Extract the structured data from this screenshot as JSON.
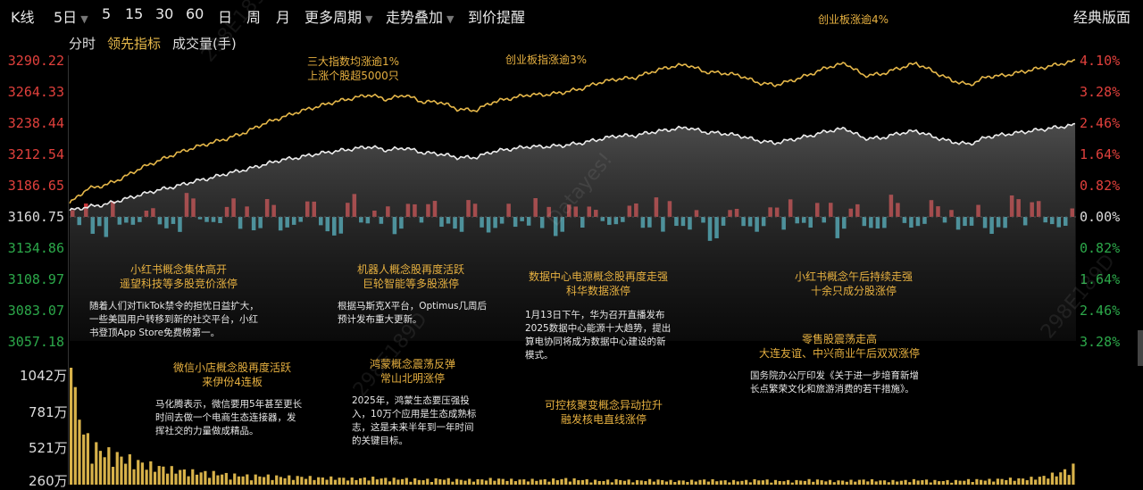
{
  "toolbar": {
    "chart_type": "K线",
    "period_5d": "5日",
    "p5": "5",
    "p15": "15",
    "p30": "30",
    "p60": "60",
    "day": "日",
    "week": "周",
    "month": "月",
    "more_periods": "更多周期",
    "trend_overlay": "走势叠加",
    "price_alert": "到价提醒",
    "classic_layout": "经典版面"
  },
  "subbar": {
    "timeshare": "分时",
    "leading_indicator": "领先指标",
    "volume": "成交量(手)"
  },
  "y_left": [
    "3290.22",
    "3264.33",
    "3238.44",
    "3212.54",
    "3186.65",
    "3160.75",
    "3134.86",
    "3108.97",
    "3083.07",
    "3057.18"
  ],
  "y_right": [
    "4.10%",
    "3.28%",
    "2.46%",
    "1.64%",
    "0.82%",
    "0.00%",
    "0.82%",
    "1.64%",
    "2.46%",
    "3.28%"
  ],
  "vol_labels": [
    "1042万",
    "781万",
    "521万",
    "260万"
  ],
  "watermarks": [
    "298E189D",
    "Datayes!",
    "298E189D",
    "298E189D"
  ],
  "annotations": [
    {
      "title": [
        "三大指数均涨逾1%",
        "上涨个股超5000只"
      ]
    },
    {
      "title": [
        "创业板指涨逾3%"
      ]
    },
    {
      "title": [
        "创业板涨逾4%"
      ]
    },
    {
      "title": [
        "小红书概念集体高开",
        "遥望科技等多股竞价涨停"
      ],
      "text": [
        "随着人们对TikTok禁令的担忧日益扩大，",
        "一些美国用户转移到新的社交平台，小红",
        "书登顶App Store免费榜第一。"
      ]
    },
    {
      "title": [
        "机器人概念股再度活跃",
        "巨轮智能等多股涨停"
      ],
      "text": [
        "根据马斯克X平台，Optimus几周后",
        "预计发布重大更新。"
      ]
    },
    {
      "title": [
        "数据中心电源概念股再度走强",
        "科华数据涨停"
      ],
      "text": [
        "1月13日下午，华为召开直播发布",
        "2025数据中心能源十大趋势，提出",
        "算电协同将成为数据中心建设的新",
        "模式。"
      ]
    },
    {
      "title": [
        "小红书概念午后持续走强",
        "十余只成分股涨停"
      ]
    },
    {
      "title": [
        "零售股震荡走高",
        "大连友谊、中兴商业午后双双涨停"
      ],
      "text": [
        "国务院办公厅印发《关于进一步培育新增",
        "长点繁荣文化和旅游消费的若干措施》。"
      ]
    },
    {
      "title": [
        "微信小店概念股再度活跃",
        "来伊份4连板"
      ],
      "text": [
        "马化腾表示，微信要用5年甚至更长",
        "时间去做一个电商生态连接器，发",
        "挥社交的力量做成精品。"
      ]
    },
    {
      "title": [
        "鸿蒙概念震荡反弹",
        "常山北明涨停"
      ],
      "text": [
        "2025年，鸿蒙生态要压强投",
        "入，10万个应用是生态成熟标",
        "志，这是未来半年到一年时间",
        "的关键目标。"
      ]
    },
    {
      "title": [
        "可控核聚变概念异动拉升",
        "融发核电直线涨停"
      ]
    }
  ],
  "chart_data": {
    "type": "line",
    "x": "intraday",
    "y_range": [
      3057.18,
      3290.22
    ],
    "base_value": 3160.75,
    "series": [
      {
        "color": "#e6b84a",
        "values": [
          3172,
          3184,
          3187,
          3193,
          3201,
          3207,
          3213,
          3218,
          3222,
          3226,
          3231,
          3238,
          3243,
          3248,
          3252,
          3256,
          3259,
          3262,
          3258,
          3262,
          3256,
          3256,
          3250,
          3249,
          3256,
          3259,
          3262,
          3262,
          3264,
          3267,
          3272,
          3275,
          3276,
          3281,
          3285,
          3287,
          3281,
          3280,
          3278,
          3272,
          3270,
          3274,
          3279,
          3285,
          3288,
          3278,
          3279,
          3284,
          3288,
          3281,
          3274,
          3270,
          3277,
          3278,
          3281,
          3284,
          3287,
          3290
        ]
      },
      {
        "color": "#ececec",
        "values": [
          3166,
          3169,
          3171,
          3175,
          3179,
          3183,
          3186,
          3190,
          3193,
          3197,
          3200,
          3204,
          3208,
          3210,
          3213,
          3215,
          3217,
          3219,
          3216,
          3218,
          3214,
          3213,
          3210,
          3210,
          3215,
          3217,
          3219,
          3219,
          3220,
          3222,
          3225,
          3228,
          3228,
          3231,
          3233,
          3235,
          3231,
          3230,
          3228,
          3224,
          3222,
          3225,
          3228,
          3232,
          3234,
          3226,
          3226,
          3230,
          3232,
          3227,
          3223,
          3221,
          3227,
          3229,
          3231,
          3233,
          3235,
          3237
        ]
      }
    ],
    "bars": [
      0.5,
      -0.8,
      0.6,
      -0.3,
      0.4,
      -0.5,
      0.9,
      -0.2,
      0.5,
      0.7,
      -0.6,
      0.8,
      -0.4,
      0.6,
      -0.7,
      1.0,
      -0.3,
      0.4,
      -0.9,
      0.5,
      0.6,
      -0.5,
      0.8,
      -0.6,
      0.5,
      -0.4,
      0.7,
      -0.8,
      0.6,
      0.4,
      -0.3,
      0.5,
      -0.7,
      0.8,
      -0.5,
      0.4,
      -0.9,
      0.3,
      -0.6,
      0.5,
      0.7,
      -0.4,
      0.6,
      -0.8,
      0.5,
      -0.6,
      0.9,
      -0.4,
      0.7,
      0.4,
      -0.5,
      0.6,
      -0.7,
      0.8,
      0.6,
      -0.4,
      0.5,
      0.3
    ],
    "volume": [
      1.0,
      0.42,
      0.33,
      0.28,
      0.22,
      0.18,
      0.15,
      0.13,
      0.12,
      0.1,
      0.09,
      0.09,
      0.08,
      0.08,
      0.07,
      0.07,
      0.06,
      0.07,
      0.06,
      0.06,
      0.05,
      0.06,
      0.05,
      0.05,
      0.06,
      0.05,
      0.05,
      0.05,
      0.06,
      0.05,
      0.04,
      0.05,
      0.04,
      0.05,
      0.04,
      0.04,
      0.05,
      0.04,
      0.04,
      0.05,
      0.04,
      0.04,
      0.05,
      0.04,
      0.04,
      0.05,
      0.04,
      0.04,
      0.05,
      0.04,
      0.04,
      0.05,
      0.05,
      0.06,
      0.06,
      0.08,
      0.12,
      0.2
    ]
  }
}
